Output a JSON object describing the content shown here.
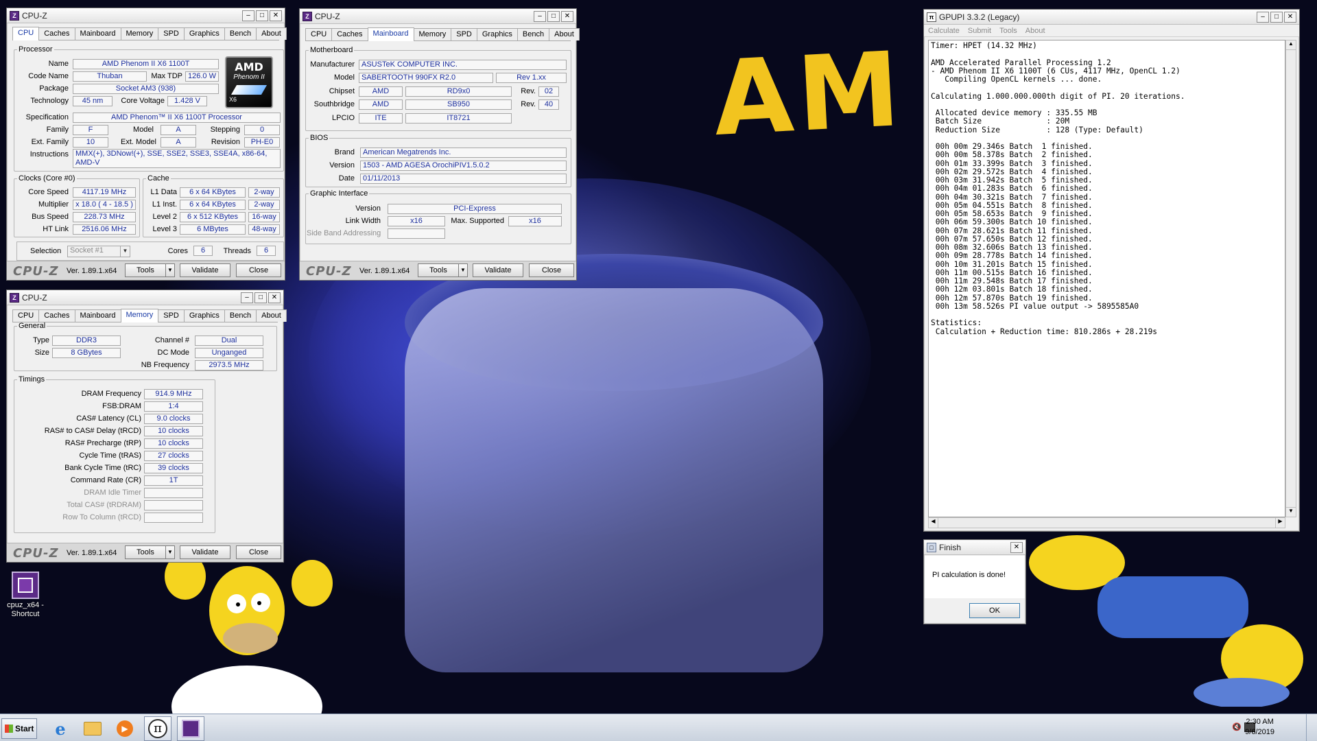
{
  "desktop": {
    "banner_text": "AM CUP",
    "icon_label": "cpuz_x64 - Shortcut"
  },
  "cpuz_common": {
    "title": "CPU-Z",
    "tabs": [
      "CPU",
      "Caches",
      "Mainboard",
      "Memory",
      "SPD",
      "Graphics",
      "Bench",
      "About"
    ],
    "logo": "CPU-Z",
    "version": "Ver. 1.89.1.x64",
    "tools_label": "Tools",
    "validate_label": "Validate",
    "close_label": "Close"
  },
  "cpu_tab": {
    "processor_legend": "Processor",
    "name_label": "Name",
    "name": "AMD Phenom II X6 1100T",
    "codename_label": "Code Name",
    "codename": "Thuban",
    "maxtdp_label": "Max TDP",
    "maxtdp": "126.0 W",
    "package_label": "Package",
    "package": "Socket AM3 (938)",
    "technology_label": "Technology",
    "technology": "45 nm",
    "corevoltage_label": "Core Voltage",
    "corevoltage": "1.428 V",
    "spec_label": "Specification",
    "spec": "AMD Phenom™ II X6 1100T Processor",
    "family_label": "Family",
    "family": "F",
    "model_label": "Model",
    "model": "A",
    "stepping_label": "Stepping",
    "stepping": "0",
    "extfamily_label": "Ext. Family",
    "extfamily": "10",
    "extmodel_label": "Ext. Model",
    "extmodel": "A",
    "revision_label": "Revision",
    "revision": "PH-E0",
    "instructions_label": "Instructions",
    "instructions": "MMX(+), 3DNow!(+), SSE, SSE2, SSE3, SSE4A, x86-64, AMD-V",
    "clocks_legend": "Clocks (Core #0)",
    "corespeed_label": "Core Speed",
    "corespeed": "4117.19 MHz",
    "multiplier_label": "Multiplier",
    "multiplier": "x 18.0 ( 4 - 18.5 )",
    "busspeed_label": "Bus Speed",
    "busspeed": "228.73 MHz",
    "htlink_label": "HT Link",
    "htlink": "2516.06 MHz",
    "cache_legend": "Cache",
    "l1data_label": "L1 Data",
    "l1data": "6 x 64 KBytes",
    "l1data_way": "2-way",
    "l1inst_label": "L1 Inst.",
    "l1inst": "6 x 64 KBytes",
    "l1inst_way": "2-way",
    "level2_label": "Level 2",
    "level2": "6 x 512 KBytes",
    "level2_way": "16-way",
    "level3_label": "Level 3",
    "level3": "6 MBytes",
    "level3_way": "48-way",
    "selection_label": "Selection",
    "selection": "Socket #1",
    "cores_label": "Cores",
    "cores": "6",
    "threads_label": "Threads",
    "threads": "6",
    "amd_logo_text": "AMD",
    "amd_logo_sub": "Phenom II",
    "amd_logo_x6": "X6"
  },
  "mainboard_tab": {
    "motherboard_legend": "Motherboard",
    "manufacturer_label": "Manufacturer",
    "manufacturer": "ASUSTeK COMPUTER INC.",
    "model_label": "Model",
    "model": "SABERTOOTH 990FX R2.0",
    "model_rev": "Rev 1.xx",
    "chipset_label": "Chipset",
    "chipset_vendor": "AMD",
    "chipset": "RD9x0",
    "chipset_rev_label": "Rev.",
    "chipset_rev": "02",
    "southbridge_label": "Southbridge",
    "sb_vendor": "AMD",
    "southbridge": "SB950",
    "sb_rev_label": "Rev.",
    "sb_rev": "40",
    "lpcio_label": "LPCIO",
    "lpcio_vendor": "ITE",
    "lpcio": "IT8721",
    "bios_legend": "BIOS",
    "brand_label": "Brand",
    "brand": "American Megatrends Inc.",
    "version_label": "Version",
    "version": "1503 - AMD AGESA OrochiPIV1.5.0.2",
    "date_label": "Date",
    "date": "01/11/2013",
    "graphic_legend": "Graphic Interface",
    "gi_version_label": "Version",
    "gi_version": "PCI-Express",
    "linkwidth_label": "Link Width",
    "linkwidth": "x16",
    "maxsupported_label": "Max. Supported",
    "maxsupported": "x16",
    "sideband_label": "Side Band Addressing"
  },
  "memory_tab": {
    "general_legend": "General",
    "type_label": "Type",
    "type": "DDR3",
    "channel_label": "Channel #",
    "channel": "Dual",
    "size_label": "Size",
    "size": "8 GBytes",
    "dcmode_label": "DC Mode",
    "dcmode": "Unganged",
    "nbfreq_label": "NB Frequency",
    "nbfreq": "2973.5 MHz",
    "timings_legend": "Timings",
    "timings": [
      {
        "label": "DRAM Frequency",
        "value": "914.9 MHz"
      },
      {
        "label": "FSB:DRAM",
        "value": "1:4"
      },
      {
        "label": "CAS# Latency (CL)",
        "value": "9.0 clocks"
      },
      {
        "label": "RAS# to CAS# Delay (tRCD)",
        "value": "10 clocks"
      },
      {
        "label": "RAS# Precharge (tRP)",
        "value": "10 clocks"
      },
      {
        "label": "Cycle Time (tRAS)",
        "value": "27 clocks"
      },
      {
        "label": "Bank Cycle Time (tRC)",
        "value": "39 clocks"
      },
      {
        "label": "Command Rate (CR)",
        "value": "1T"
      },
      {
        "label": "DRAM Idle Timer",
        "value": ""
      },
      {
        "label": "Total CAS# (tRDRAM)",
        "value": ""
      },
      {
        "label": "Row To Column (tRCD)",
        "value": ""
      }
    ]
  },
  "gpupi": {
    "title": "GPUPI 3.3.2 (Legacy)",
    "menu": [
      "Calculate",
      "Submit",
      "Tools",
      "About"
    ],
    "lines": [
      "Timer: HPET (14.32 MHz)",
      "",
      "AMD Accelerated Parallel Processing 1.2",
      "- AMD Phenom II X6 1100T (6 CUs, 4117 MHz, OpenCL 1.2)",
      "   Compiling OpenCL kernels ... done.",
      "",
      "Calculating 1.000.000.000th digit of PI. 20 iterations.",
      "",
      " Allocated device memory : 335.55 MB",
      " Batch Size              : 20M",
      " Reduction Size          : 128 (Type: Default)",
      "",
      " 00h 00m 29.346s Batch  1 finished.",
      " 00h 00m 58.378s Batch  2 finished.",
      " 00h 01m 33.399s Batch  3 finished.",
      " 00h 02m 29.572s Batch  4 finished.",
      " 00h 03m 31.942s Batch  5 finished.",
      " 00h 04m 01.283s Batch  6 finished.",
      " 00h 04m 30.321s Batch  7 finished.",
      " 00h 05m 04.551s Batch  8 finished.",
      " 00h 05m 58.653s Batch  9 finished.",
      " 00h 06m 59.300s Batch 10 finished.",
      " 00h 07m 28.621s Batch 11 finished.",
      " 00h 07m 57.650s Batch 12 finished.",
      " 00h 08m 32.606s Batch 13 finished.",
      " 00h 09m 28.778s Batch 14 finished.",
      " 00h 10m 31.201s Batch 15 finished.",
      " 00h 11m 00.515s Batch 16 finished.",
      " 00h 11m 29.548s Batch 17 finished.",
      " 00h 12m 03.801s Batch 18 finished.",
      " 00h 12m 57.870s Batch 19 finished.",
      " 00h 13m 58.526s PI value output -> 5895585A0",
      "",
      "Statistics:",
      " Calculation + Reduction time: 810.286s + 28.219s"
    ]
  },
  "finish_dialog": {
    "title": "Finish",
    "message": "PI calculation is done!",
    "ok_label": "OK"
  },
  "taskbar": {
    "start_label": "Start",
    "time": "2:30 AM",
    "date": "9/6/2019"
  }
}
